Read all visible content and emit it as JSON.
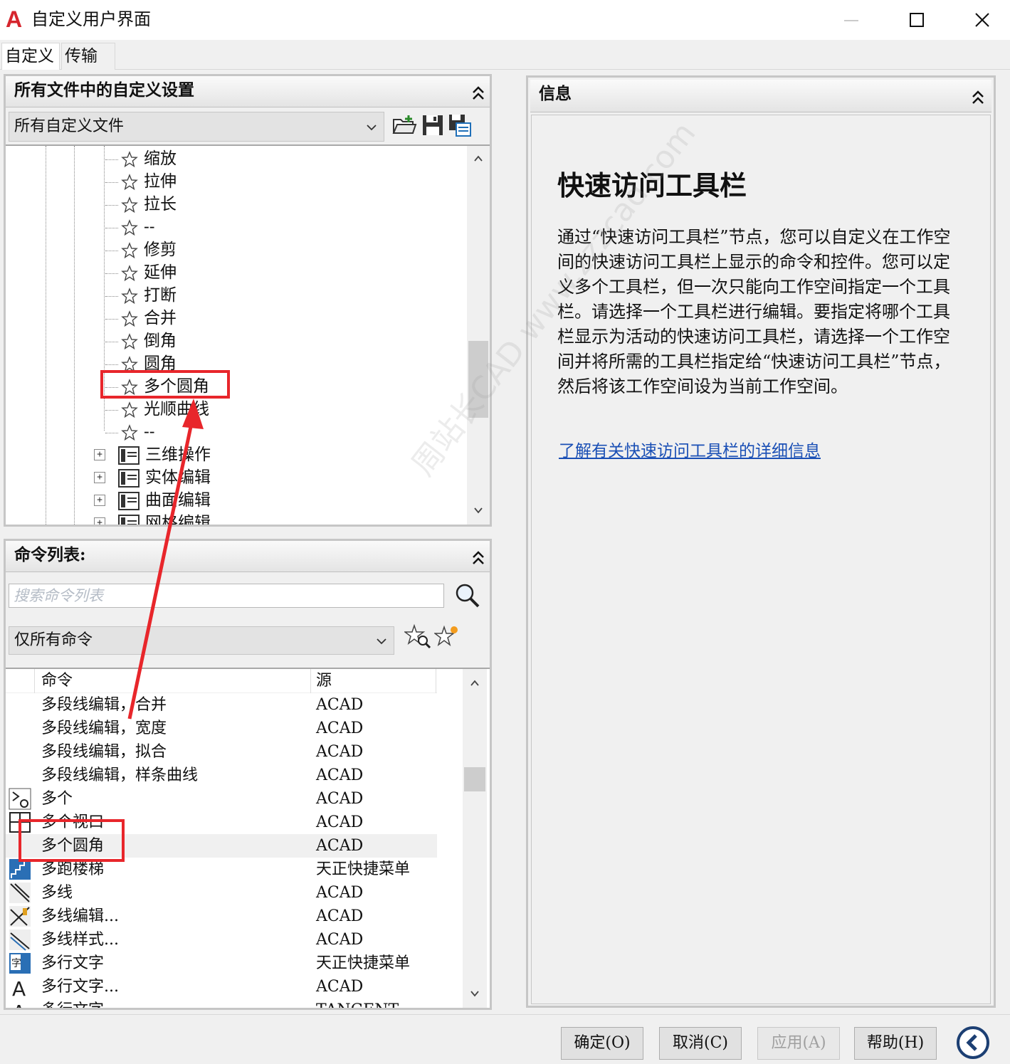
{
  "window": {
    "title": "自定义用户界面",
    "logo_letter": "A"
  },
  "tabs": [
    {
      "label": "自定义",
      "active": true
    },
    {
      "label": "传输",
      "active": false
    }
  ],
  "customizations_panel": {
    "header": "所有文件中的自定义设置",
    "files_dropdown": "所有自定义文件",
    "tree_items": [
      {
        "label": "缩放",
        "type": "command"
      },
      {
        "label": "拉伸",
        "type": "command"
      },
      {
        "label": "拉长",
        "type": "command"
      },
      {
        "label": "--",
        "type": "command"
      },
      {
        "label": "修剪",
        "type": "command"
      },
      {
        "label": "延伸",
        "type": "command"
      },
      {
        "label": "打断",
        "type": "command"
      },
      {
        "label": "合并",
        "type": "command"
      },
      {
        "label": "倒角",
        "type": "command"
      },
      {
        "label": "圆角",
        "type": "command"
      },
      {
        "label": "多个圆角",
        "type": "command",
        "highlighted": true
      },
      {
        "label": "光顺曲线",
        "type": "command"
      },
      {
        "label": "--",
        "type": "command"
      },
      {
        "label": "三维操作",
        "type": "group"
      },
      {
        "label": "实体编辑",
        "type": "group"
      },
      {
        "label": "曲面编辑",
        "type": "group"
      },
      {
        "label": "网格编辑",
        "type": "group"
      }
    ]
  },
  "command_list_panel": {
    "header": "命令列表:",
    "search_placeholder": "搜索命令列表",
    "filter_dropdown": "仅所有命令",
    "columns": {
      "command": "命令",
      "source": "源"
    },
    "rows": [
      {
        "command": "多段线编辑，合并",
        "source": "ACAD",
        "icon": "none"
      },
      {
        "command": "多段线编辑，宽度",
        "source": "ACAD",
        "icon": "none"
      },
      {
        "command": "多段线编辑，拟合",
        "source": "ACAD",
        "icon": "none"
      },
      {
        "command": "多段线编辑，样条曲线",
        "source": "ACAD",
        "icon": "none"
      },
      {
        "command": "多个",
        "source": "ACAD",
        "icon": "multiple-icon"
      },
      {
        "command": "多个视口",
        "source": "ACAD",
        "icon": "viewport-icon"
      },
      {
        "command": "多个圆角",
        "source": "ACAD",
        "icon": "none",
        "selected": true
      },
      {
        "command": "多跑楼梯",
        "source": "天正快捷菜单",
        "icon": "stairs-icon"
      },
      {
        "command": "多线",
        "source": "ACAD",
        "icon": "mline-icon"
      },
      {
        "command": "多线编辑...",
        "source": "ACAD",
        "icon": "mline-edit-icon"
      },
      {
        "command": "多线样式...",
        "source": "ACAD",
        "icon": "mline-style-icon"
      },
      {
        "command": "多行文字",
        "source": "天正快捷菜单",
        "icon": "mtext-tangent-icon"
      },
      {
        "command": "多行文字...",
        "source": "ACAD",
        "icon": "mtext-icon"
      },
      {
        "command": "多行文字",
        "source": "TANGENT",
        "icon": "mtext-icon"
      }
    ]
  },
  "info_panel": {
    "header": "信息",
    "title": "快速访问工具栏",
    "body": "通过“快速访问工具栏”节点，您可以自定义在工作空间的快速访问工具栏上显示的命令和控件。您可以定义多个工具栏，但一次只能向工作空间指定一个工具栏。请选择一个工具栏进行编辑。要指定将哪个工具栏显示为活动的快速访问工具栏，请选择一个工作空间并将所需的工具栏指定给“快速访问工具栏”节点，然后将该工作空间设为当前工作空间。",
    "link": "了解有关快速访问工具栏的详细信息"
  },
  "buttons": {
    "ok": "确定(O)",
    "cancel": "取消(C)",
    "apply": "应用(A)",
    "help": "帮助(H)"
  },
  "watermark": "周站长CAD  www.zzzcad.com",
  "colors": {
    "annotation_red": "#e8262b",
    "link_blue": "#1a4fb5",
    "logo_red": "#d6262e"
  }
}
